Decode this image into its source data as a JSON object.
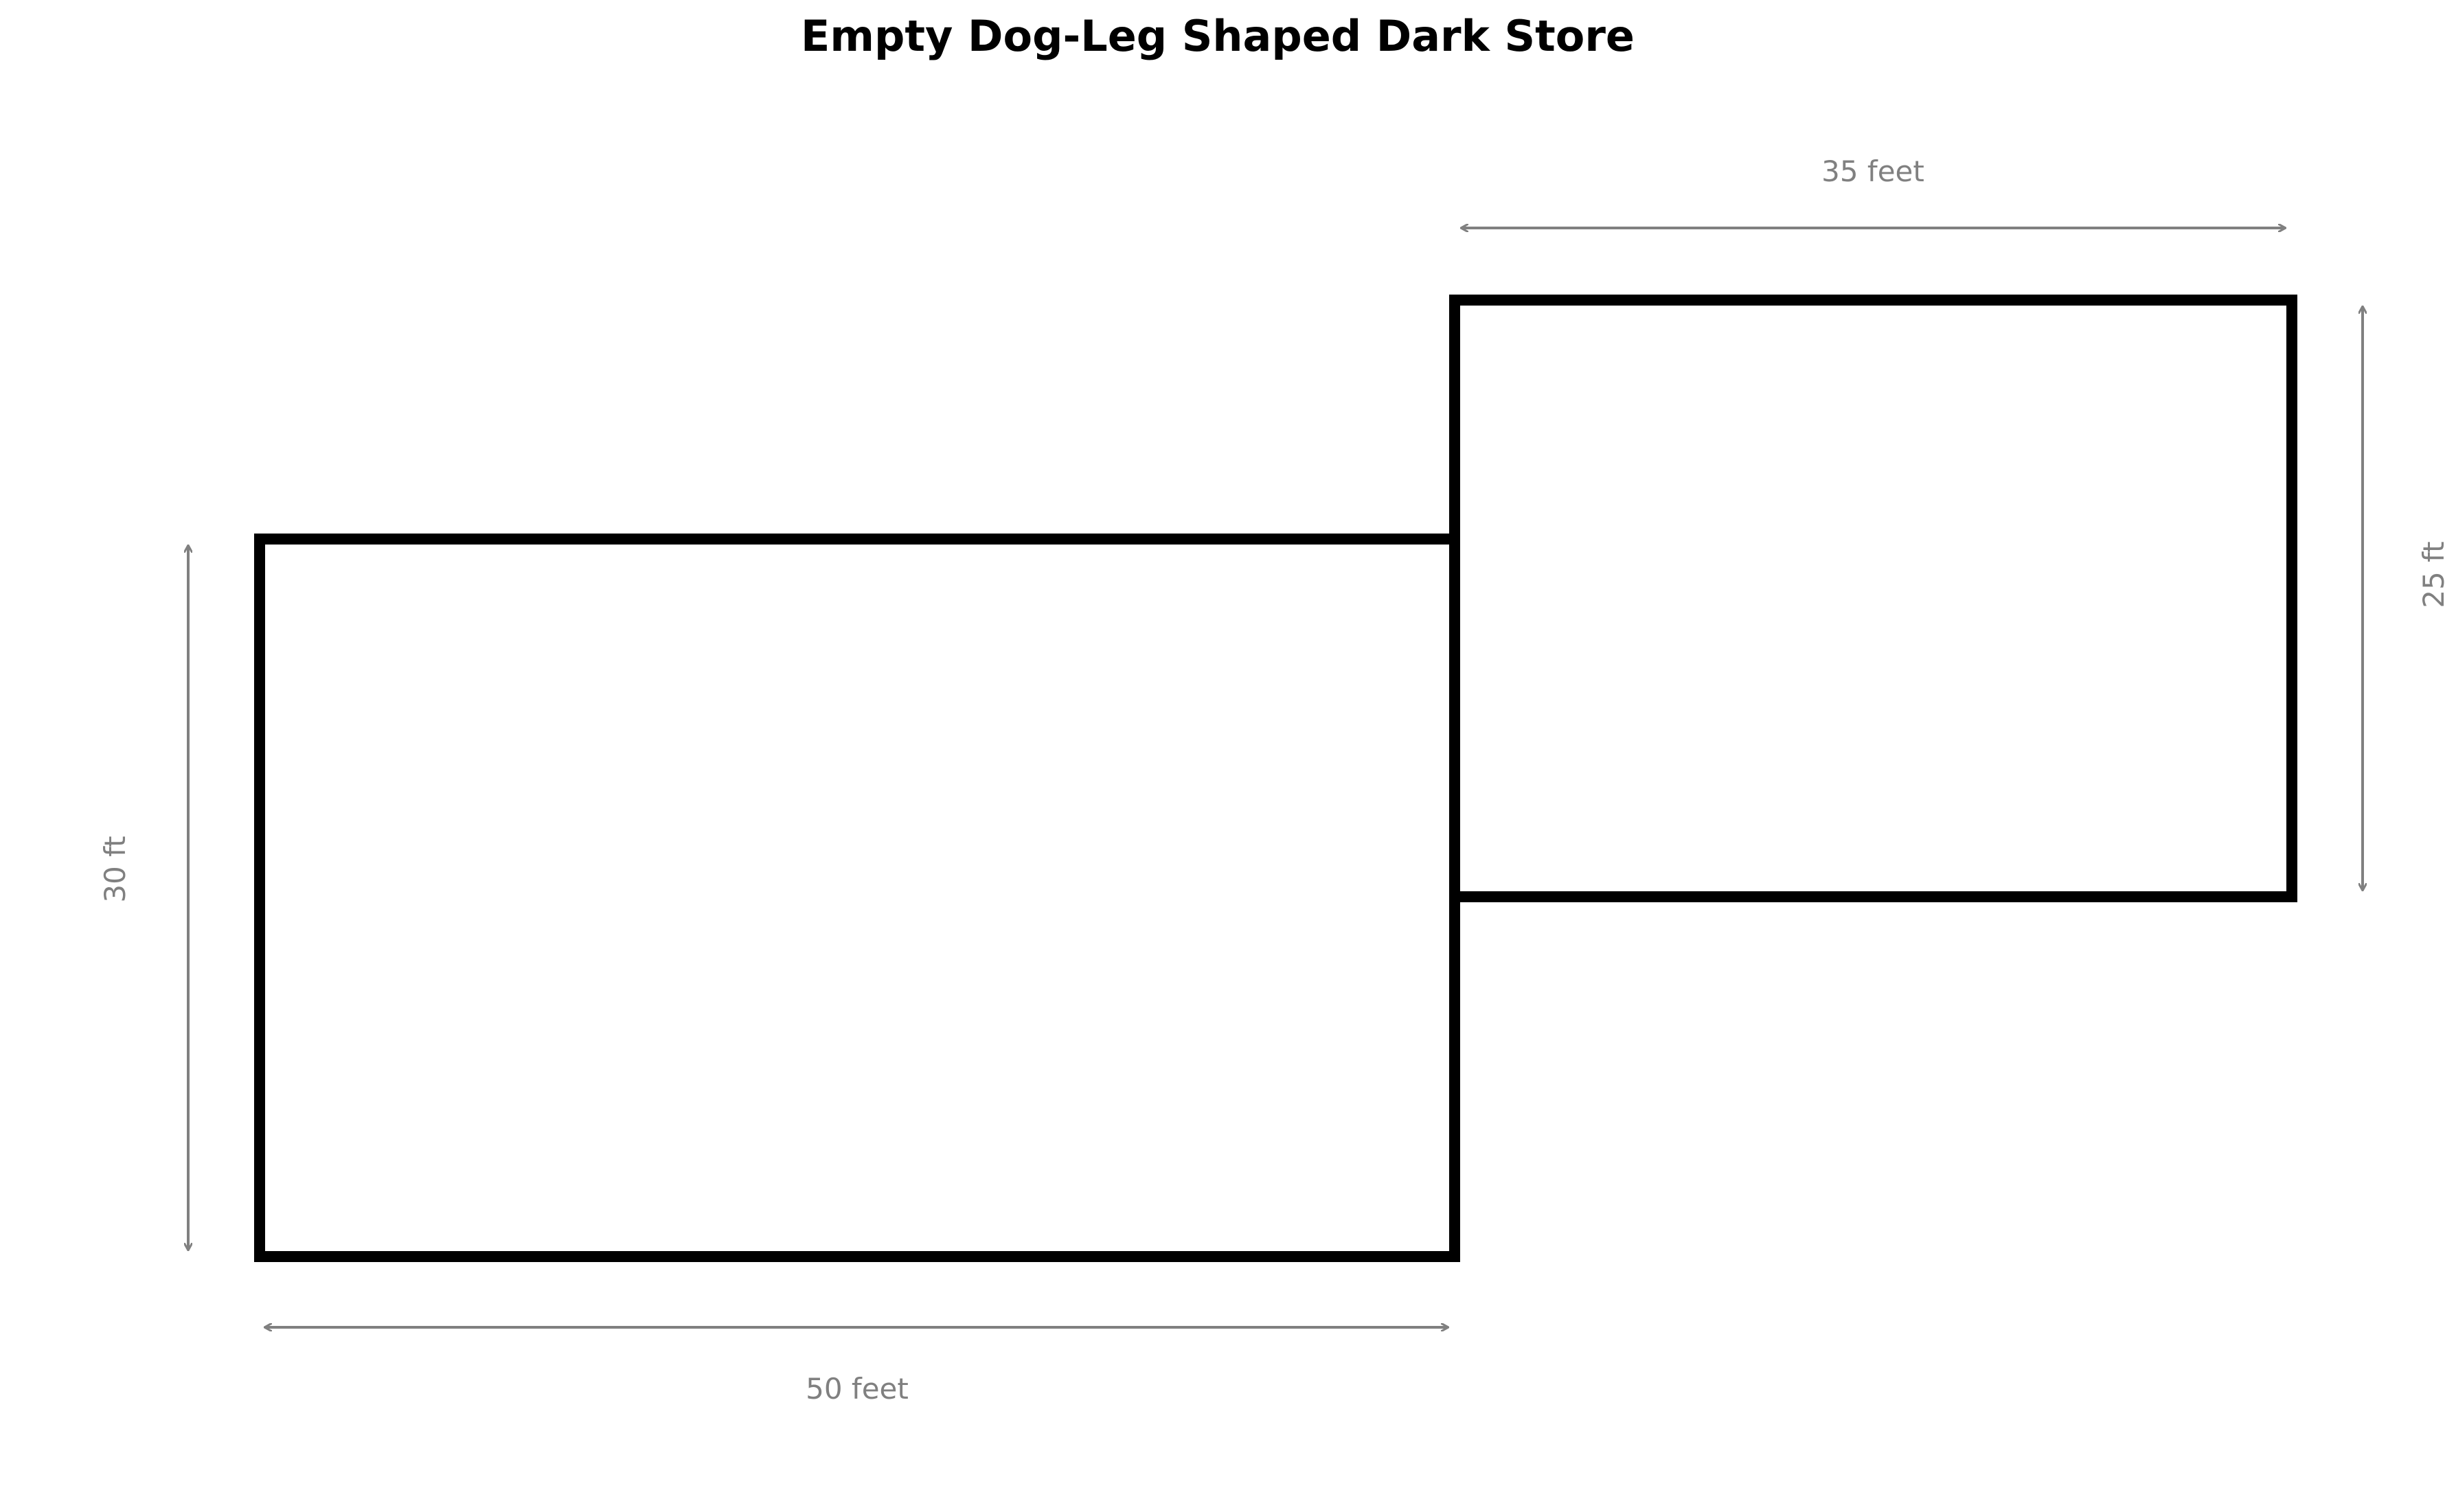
{
  "title": "Empty Dog-Leg Shaped Dark Store",
  "dimensions": {
    "large_width": "50 feet",
    "large_height": "30 ft",
    "small_width": "35 feet",
    "small_height": "25 ft"
  },
  "colors": {
    "outline": "#000000",
    "dimension": "#808080",
    "background": "#ffffff"
  }
}
